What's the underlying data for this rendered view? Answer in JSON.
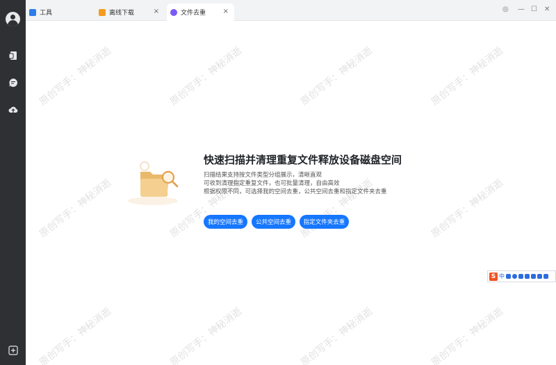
{
  "tabs": [
    {
      "label": "工具",
      "icon": "toolbox-icon",
      "color": "#2b7de9",
      "active": false
    },
    {
      "label": "离线下载",
      "icon": "download-icon",
      "color": "#f29d1f",
      "active": false
    },
    {
      "label": "文件去重",
      "icon": "dedupe-icon",
      "color": "#7a5af8",
      "active": true
    }
  ],
  "tab_close_glyph": "×",
  "window_controls": {
    "settings": "◎",
    "minimize": "—",
    "maximize": "☐",
    "close": "✕"
  },
  "watermark": "原创写手：神秘消逝",
  "feature": {
    "headline": "快速扫描并清理重复文件释放设备磁盘空间",
    "lines": [
      "扫描结果支持按文件类型分组展示，清晰直观",
      "可收到清理指定重复文件，也可批量清理，自由高效",
      "根据权限不同，可选择我的空间去重，公共空间去重和指定文件夹去重"
    ],
    "buttons": [
      "我的空间去重",
      "公共空间去重",
      "指定文件夹去重"
    ]
  },
  "ime": {
    "logo": "S",
    "lang": "中"
  },
  "colors": {
    "primary": "#1677ff",
    "sidebar": "#2f3033",
    "tabbar": "#f2f3f5"
  }
}
